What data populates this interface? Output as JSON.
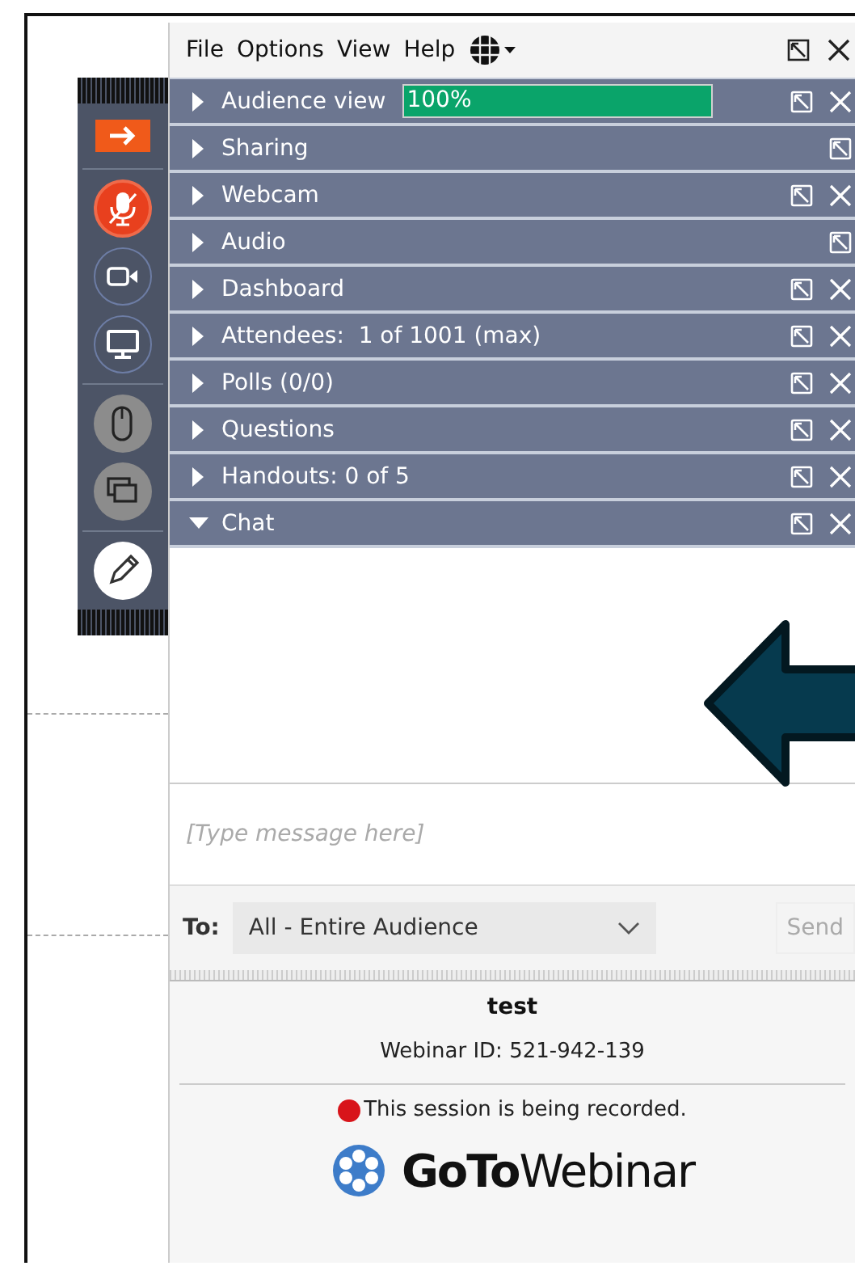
{
  "menu": [
    "File",
    "Options",
    "View",
    "Help"
  ],
  "toolbar": {
    "mic_muted": true
  },
  "panels": [
    {
      "label": "Audience view",
      "expanded": false,
      "closable": true,
      "meter": {
        "level": 1.0,
        "reading": "100%"
      }
    },
    {
      "label": "Sharing",
      "expanded": false,
      "closable": false
    },
    {
      "label": "Webcam",
      "expanded": false,
      "closable": true
    },
    {
      "label": "Audio",
      "expanded": false,
      "closable": false
    },
    {
      "label": "Dashboard",
      "expanded": false,
      "closable": true
    },
    {
      "label": "Attendees:  1 of 1001 (max)",
      "expanded": false,
      "closable": true
    },
    {
      "label": "Polls (0/0)",
      "expanded": false,
      "closable": true
    },
    {
      "label": "Questions",
      "expanded": false,
      "closable": true
    },
    {
      "label": "Handouts: 0 of 5",
      "expanded": false,
      "closable": true
    },
    {
      "label": "Chat",
      "expanded": true,
      "closable": true
    }
  ],
  "chat": {
    "placeholder": "[Type message here]",
    "to_label": "To:",
    "recipient": "All - Entire Audience",
    "send": "Send",
    "send_disabled": true
  },
  "info": {
    "title": "test",
    "webinar_id": "Webinar ID: 521-942-139",
    "recording": true,
    "recording_text": "This session is being recorded.",
    "brand_bold": "GoTo",
    "brand_light": "Webinar"
  }
}
